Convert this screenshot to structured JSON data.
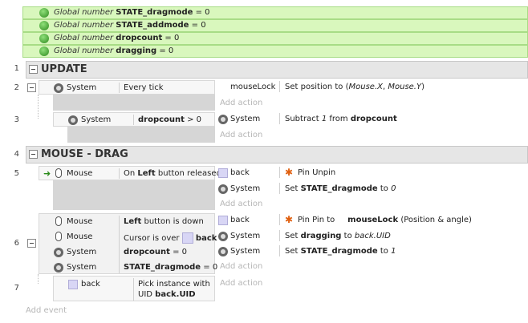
{
  "globals": [
    {
      "prefix": "Global number",
      "name": "STATE_dragmode",
      "value": "= 0"
    },
    {
      "prefix": "Global number",
      "name": "STATE_addmode",
      "value": "= 0"
    },
    {
      "prefix": "Global number",
      "name": "dropcount",
      "value": "= 0"
    },
    {
      "prefix": "Global number",
      "name": "dragging",
      "value": "= 0"
    }
  ],
  "line_numbers": [
    "1",
    "2",
    "3",
    "4",
    "5",
    "6",
    "7"
  ],
  "groups": [
    {
      "title": "UPDATE"
    },
    {
      "title": "MOUSE - DRAG"
    }
  ],
  "e2": {
    "cond_obj": "System",
    "cond_text": "Every tick",
    "act_obj": "mouseLock",
    "act_text": "Set position to (",
    "act_ital": "Mouse.X",
    "act_comma": ", ",
    "act_ital2": "Mouse.Y",
    "act_close": ")",
    "add_action": "Add action"
  },
  "e3": {
    "cond_obj": "System",
    "cond_bold": "dropcount",
    "cond_text": "> 0",
    "act_obj": "System",
    "act_text": "Subtract",
    "act_ital": "1",
    "act_mid": "from",
    "act_bold": "dropcount",
    "add_action": "Add action"
  },
  "e5": {
    "cond_obj": "Mouse",
    "cond_pre": "On",
    "cond_bold": "Left",
    "cond_text": "button released",
    "a1_obj": "back",
    "a1_text": "Pin Unpin",
    "a2_obj": "System",
    "a2_text": "Set",
    "a2_bold": "STATE_dragmode",
    "a2_mid": "to",
    "a2_ital": "0",
    "add_action": "Add action"
  },
  "e6": {
    "c1_obj": "Mouse",
    "c1_bold": "Left",
    "c1_text": "button is down",
    "c2_obj": "Mouse",
    "c2_text": "Cursor is over",
    "c2_bold": "back",
    "c3_obj": "System",
    "c3_bold": "dropcount",
    "c3_text": "= 0",
    "c4_obj": "System",
    "c4_bold": "STATE_dragmode",
    "c4_text": "= 0",
    "a1_obj": "back",
    "a1_text": "Pin Pin to",
    "a1_bold": "mouseLock",
    "a1_tail": "(Position & angle)",
    "a2_obj": "System",
    "a2_text": "Set",
    "a2_bold": "dragging",
    "a2_mid": "to",
    "a2_ital": "back.UID",
    "a3_obj": "System",
    "a3_text": "Set",
    "a3_bold": "STATE_dragmode",
    "a3_mid": "to",
    "a3_ital": "1",
    "add_action": "Add action"
  },
  "e7": {
    "cond_obj": "back",
    "cond_text": "Pick instance with",
    "cond_line2": "UID",
    "cond_bold": "back.UID",
    "add_action": "Add action"
  },
  "add_event": "Add event"
}
